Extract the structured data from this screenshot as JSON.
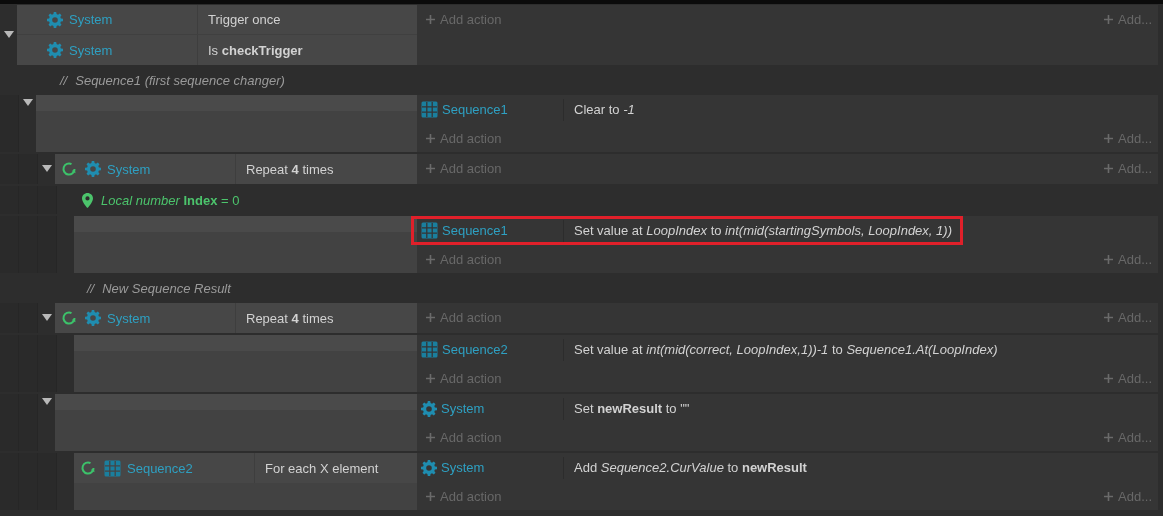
{
  "events": [
    {
      "kind": "event",
      "expanded": true,
      "conditions": [
        {
          "loop": false,
          "kind": "system",
          "object": "System",
          "text": "Trigger once"
        },
        {
          "loop": false,
          "kind": "system",
          "object": "System",
          "text": "Is **checkTrigger**"
        }
      ],
      "add_action": "Add action",
      "add_more": "Add...",
      "children": [
        {
          "kind": "comment",
          "prefix": "//",
          "text": "Sequence1  (first sequence changer)"
        },
        {
          "kind": "event",
          "expanded": true,
          "actions": [
            {
              "kind": "array",
              "object": "Sequence1",
              "text": "Clear to *-1*",
              "highlighted": false
            }
          ],
          "add_action": "Add action",
          "add_more": "Add...",
          "children": [
            {
              "kind": "event",
              "expanded": true,
              "conditions": [
                {
                  "loop": true,
                  "kind": "system",
                  "object": "System",
                  "text": "Repeat **4** times"
                }
              ],
              "add_action": "Add action",
              "add_more": "Add...",
              "children": [
                {
                  "kind": "variable",
                  "text": "*Local number* **Index** = 0"
                },
                {
                  "kind": "event",
                  "actions": [
                    {
                      "kind": "array",
                      "object": "Sequence1",
                      "text": "Set value at *LoopIndex* to *int(mid(startingSymbols, LoopIndex, 1))*",
                      "highlighted": true
                    }
                  ],
                  "add_action": "Add action",
                  "add_more": "Add..."
                }
              ]
            },
            {
              "kind": "comment",
              "prefix": "//",
              "text": "New Sequence Result"
            },
            {
              "kind": "event",
              "expanded": true,
              "conditions": [
                {
                  "loop": true,
                  "kind": "system",
                  "object": "System",
                  "text": "Repeat **4** times"
                }
              ],
              "add_action": "Add action",
              "add_more": "Add...",
              "children": [
                {
                  "kind": "event",
                  "actions": [
                    {
                      "kind": "array",
                      "object": "Sequence2",
                      "text": "Set value at *int(mid(correct, LoopIndex,1))-1* to *Sequence1.At(LoopIndex)*",
                      "highlighted": false
                    }
                  ],
                  "add_action": "Add action",
                  "add_more": "Add..."
                }
              ]
            },
            {
              "kind": "event",
              "expanded": true,
              "actions": [
                {
                  "kind": "system",
                  "object": "System",
                  "text": "Set **newResult** to \"\"",
                  "highlighted": false
                }
              ],
              "add_action": "Add action",
              "add_more": "Add...",
              "children": [
                {
                  "kind": "event",
                  "conditions": [
                    {
                      "loop": true,
                      "kind": "array",
                      "object": "Sequence2",
                      "text": "For each X element"
                    }
                  ],
                  "actions": [
                    {
                      "kind": "system",
                      "object": "System",
                      "text": "Add *Sequence2.CurValue* to **newResult**",
                      "highlighted": false
                    }
                  ],
                  "add_action": "Add action",
                  "add_more": "Add..."
                }
              ]
            }
          ]
        }
      ]
    }
  ]
}
